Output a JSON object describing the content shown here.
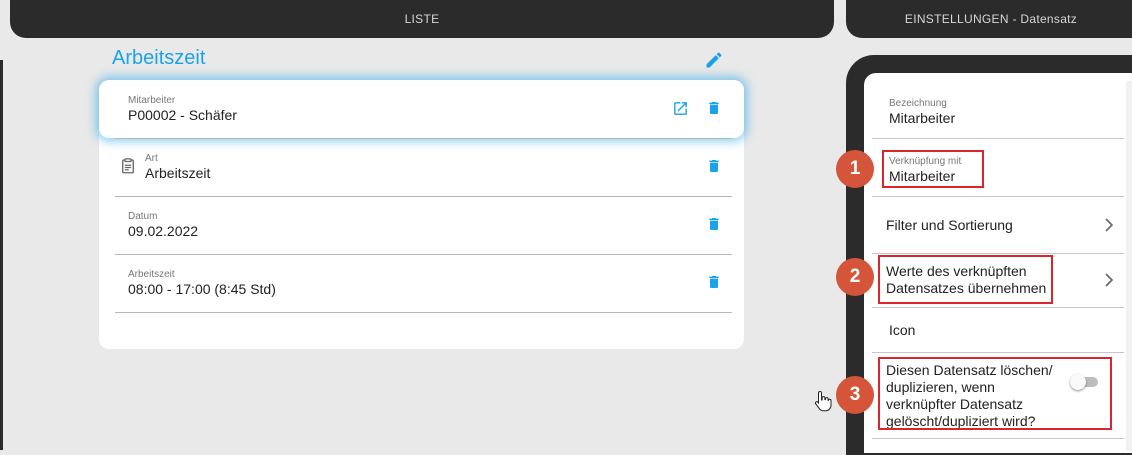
{
  "tabs": {
    "liste": "LISTE",
    "settings": "EINSTELLUNGEN - Datensatz"
  },
  "record": {
    "title": "Arbeitszeit",
    "fields": [
      {
        "label": "Mitarbeiter",
        "value": "P00002 - Schäfer"
      },
      {
        "label": "Art",
        "value": "Arbeitszeit"
      },
      {
        "label": "Datum",
        "value": "09.02.2022"
      },
      {
        "label": "Arbeitszeit",
        "value": "08:00 - 17:00 (8:45 Std)"
      }
    ]
  },
  "settings": {
    "bezeichnung_label": "Bezeichnung",
    "bezeichnung_value": "Mitarbeiter",
    "verknuepfung_label": "Verknüpfung mit",
    "verknuepfung_value": "Mitarbeiter",
    "filter": "Filter und Sortierung",
    "werte_line1": "Werte des verknüpften",
    "werte_line2": "Datensatzes übernehmen",
    "icon": "Icon",
    "delete_line1": "Diesen Datensatz löschen/",
    "delete_line2": "duplizieren, wenn",
    "delete_line3": "verknüpfter Datensatz",
    "delete_line4": "gelöscht/dupliziert wird?",
    "delete_toggle_on": false
  },
  "callouts": [
    "1",
    "2",
    "3"
  ],
  "colors": {
    "accent": "#1aa3e8",
    "dark": "#2b2b2b",
    "highlight": "#d9262c",
    "badge": "#d5553a"
  },
  "icons": [
    "edit-icon",
    "open-external-icon",
    "trash-icon",
    "clipboard-icon",
    "chevron-right-icon",
    "hand-cursor-icon"
  ]
}
